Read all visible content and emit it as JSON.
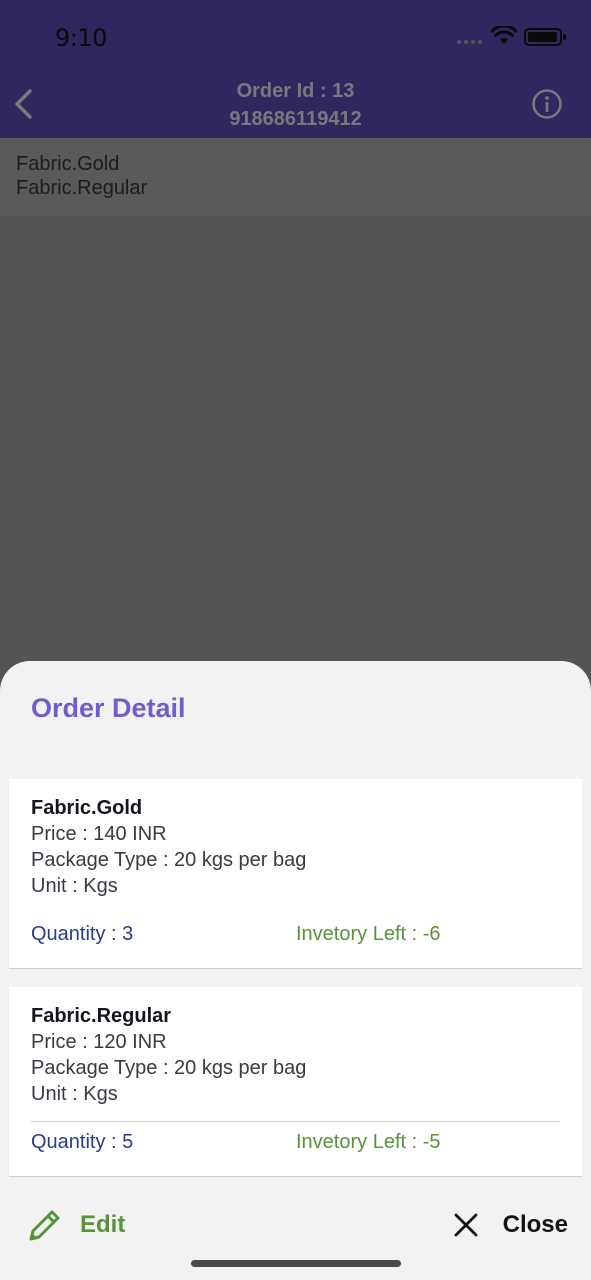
{
  "status": {
    "time": "9:10"
  },
  "nav": {
    "title_line1": "Order Id : 13",
    "title_line2": "918686119412"
  },
  "background_list": [
    "Fabric.Gold",
    "Fabric.Regular"
  ],
  "sheet": {
    "title": "Order Detail",
    "items": [
      {
        "name": "Fabric.Gold",
        "price": "Price : 140  INR",
        "package": "Package Type : 20 kgs per bag",
        "unit": "Unit : Kgs",
        "quantity": "Quantity : 3",
        "inventory": "Invetory Left : -6"
      },
      {
        "name": "Fabric.Regular",
        "price": "Price : 120  INR",
        "package": "Package Type : 20 kgs per bag",
        "unit": "Unit : Kgs",
        "quantity": "Quantity : 5",
        "inventory": "Invetory Left : -5"
      }
    ],
    "edit_label": "Edit",
    "close_label": "Close"
  },
  "colors": {
    "header_bg": "#2f275e",
    "accent_purple": "#6d5fd2",
    "green": "#58923a",
    "blue": "#2c3a8f"
  },
  "icons": [
    "back-chevron-icon",
    "info-icon",
    "wifi-icon",
    "battery-icon",
    "pencil-icon",
    "close-icon"
  ]
}
